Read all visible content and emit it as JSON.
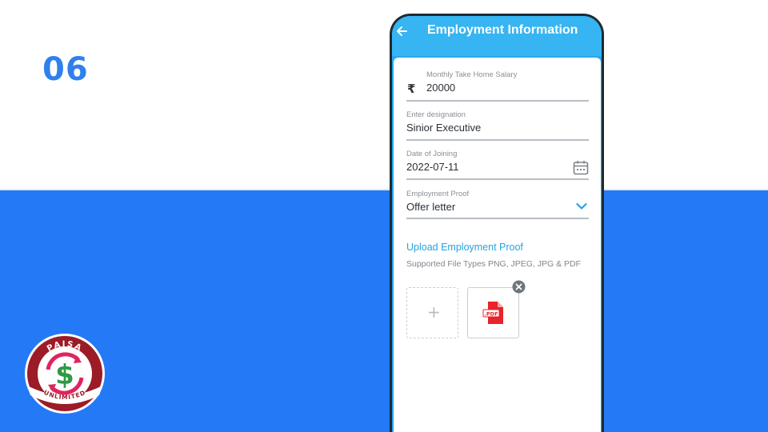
{
  "step": {
    "number": "06"
  },
  "logo": {
    "top_text": "PAISA",
    "bottom_text": "UNLIMITED",
    "symbol": "$"
  },
  "app": {
    "title": "Employment Information",
    "back_icon": "arrow-left-icon"
  },
  "form": {
    "salary": {
      "label": "Monthly Take Home Salary",
      "currency_symbol": "₹",
      "value": "20000"
    },
    "designation": {
      "label": "Enter designation",
      "value": "Sinior Executive"
    },
    "joining_date": {
      "label": "Date of Joining",
      "value": "2022-07-11",
      "icon": "calendar-icon"
    },
    "employment_proof": {
      "label": "Employment Proof",
      "value": "Offer letter",
      "icon": "chevron-down-icon"
    }
  },
  "upload": {
    "title": "Upload Employment Proof",
    "hint": "Supported File Types PNG, JPEG, JPG & PDF",
    "add_symbol": "+",
    "file_badge": ".PDF"
  },
  "colors": {
    "brand_blue": "#2479f6",
    "header_blue": "#36b5f2",
    "link_blue": "#27a3e0",
    "logo_red": "#9b1b26",
    "logo_green": "#2e9a45"
  }
}
